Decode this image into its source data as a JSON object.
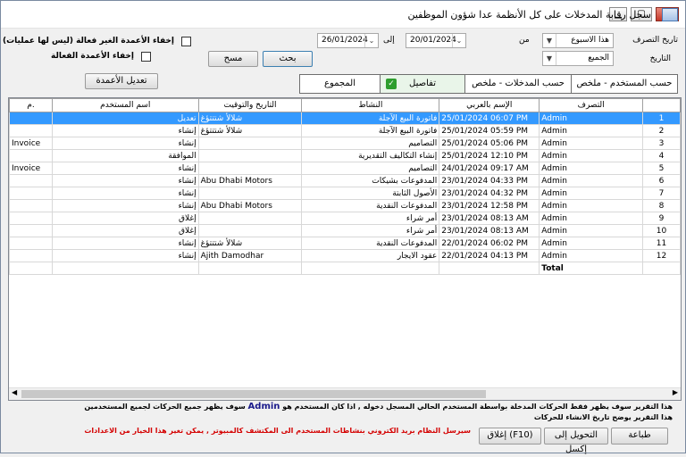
{
  "window": {
    "title": "سجل رقابة المدخلات على كل الأنظمة عدا شؤون الموظفين"
  },
  "filters": {
    "action_date_label": "تاريخ التصرف",
    "from_label": "من",
    "period_value": "هذا الاسبوع",
    "to_label": "إلى",
    "date_from": "26/01/2024",
    "date_to": "20/01/2024",
    "history_label": "التاريخ",
    "history_value": "الجميع",
    "search_label": "بحث",
    "clear_label": "مسح",
    "hide_inactive_label": "إخفاء الأعمدة الغير فعالة (ليس لها عمليات)",
    "hide_active_label": "إخفاء الأعمدة الفعالة",
    "edit_columns_label": "تعديل الأعمدة"
  },
  "tabs": [
    {
      "label": "حسب المستخدم - ملخص"
    },
    {
      "label": "حسب المدخلات - ملخص"
    },
    {
      "label": "تفاصيل"
    },
    {
      "label": "المجموع"
    }
  ],
  "table": {
    "headers": [
      "",
      "التصرف",
      "الإسم بالعربي",
      "النشاط",
      "التاريخ والتوقيت",
      "اسم المستخدم",
      "م."
    ],
    "rows": [
      {
        "extra": "",
        "action": "تعديل",
        "arabic_name": "شلالأ شتتتؤغ",
        "activity": "فاتورة البيع الآجلة",
        "datetime": "25/01/2024 06:07 PM",
        "user": "Admin",
        "no": "1"
      },
      {
        "extra": "",
        "action": "إنشاء",
        "arabic_name": "شلالأ شتتتؤغ",
        "activity": "فاتورة البيع الآجلة",
        "datetime": "25/01/2024 05:59 PM",
        "user": "Admin",
        "no": "2"
      },
      {
        "extra": "Invoice",
        "action": "إنشاء",
        "arabic_name": "",
        "activity": "التصاميم",
        "datetime": "25/01/2024 05:06 PM",
        "user": "Admin",
        "no": "3"
      },
      {
        "extra": "",
        "action": "الموافقة",
        "arabic_name": "",
        "activity": "إنشاء التكاليف التقديرية",
        "datetime": "25/01/2024 12:10 PM",
        "user": "Admin",
        "no": "4"
      },
      {
        "extra": "Invoice",
        "action": "إنشاء",
        "arabic_name": "",
        "activity": "التصاميم",
        "datetime": "24/01/2024 09:17 AM",
        "user": "Admin",
        "no": "5"
      },
      {
        "extra": "",
        "action": "إنشاء",
        "arabic_name": "Abu Dhabi Motors",
        "activity": "المدفوعات بشيكات",
        "datetime": "23/01/2024 04:33 PM",
        "user": "Admin",
        "no": "6"
      },
      {
        "extra": "",
        "action": "إنشاء",
        "arabic_name": "",
        "activity": "الأصول الثابتة",
        "datetime": "23/01/2024 04:32 PM",
        "user": "Admin",
        "no": "7"
      },
      {
        "extra": "",
        "action": "إنشاء",
        "arabic_name": "Abu Dhabi Motors",
        "activity": "المدفوعات النقدية",
        "datetime": "23/01/2024 12:58 PM",
        "user": "Admin",
        "no": "8"
      },
      {
        "extra": "",
        "action": "إغلاق",
        "arabic_name": "",
        "activity": "أمر شراء",
        "datetime": "23/01/2024 08:13 AM",
        "user": "Admin",
        "no": "9"
      },
      {
        "extra": "",
        "action": "إغلاق",
        "arabic_name": "",
        "activity": "أمر شراء",
        "datetime": "23/01/2024 08:13 AM",
        "user": "Admin",
        "no": "10"
      },
      {
        "extra": "",
        "action": "إنشاء",
        "arabic_name": "شلالأ شتتتؤغ",
        "activity": "المدفوعات النقدية",
        "datetime": "22/01/2024 06:02 PM",
        "user": "Admin",
        "no": "11"
      },
      {
        "extra": "",
        "action": "إنشاء",
        "arabic_name": "Ajith Damodhar",
        "activity": "عقود الايجار",
        "datetime": "22/01/2024 04:13 PM",
        "user": "Admin",
        "no": "12"
      }
    ],
    "total_label": "Total"
  },
  "notes": {
    "line1_a": "هذا التقرير سوف يظهر فقط الحركات المدخلة بواسطة المستخدم الحالي المسجل دخوله , اذا كان المستخدم هو",
    "line1_b": "Admin",
    "line1_c": "سوف يظهر جميع الحركات لجميع المستخدمين",
    "line2": "هذا التقرير يوضح تاريخ الانشاء للحركات",
    "line3": "سيرسل النظام بريد الكتروني بنشاطات المستخدم الى المكتشف كالمبيوتر , يمكن تغير هذا الخيار من الاعدادات",
    "line3_color": "#d40000"
  },
  "footer": {
    "print_label": "طباعة",
    "export_label": "التحويل إلى إكسل",
    "close_label": "إغلاق (F10)"
  },
  "colors": {
    "selected_row": "#3399ff",
    "accent": "#3c7fb1"
  }
}
